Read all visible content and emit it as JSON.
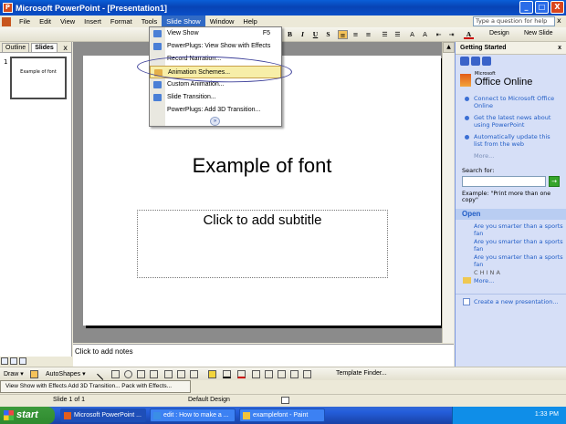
{
  "window": {
    "title": "Microsoft PowerPoint - [Presentation1]",
    "minimize_icon": "_",
    "maximize_icon": "□",
    "close_icon": "X"
  },
  "menubar": {
    "items": [
      "File",
      "Edit",
      "View",
      "Insert",
      "Format",
      "Tools",
      "Slide Show",
      "Window",
      "Help"
    ],
    "active": "Slide Show",
    "help_placeholder": "Type a question for help",
    "close_doc": "x"
  },
  "toolbar": {
    "bold": "B",
    "italic": "I",
    "underline": "U",
    "shadow": "S",
    "design": "Design",
    "new_slide": "New Slide",
    "font_color_label": "A"
  },
  "slides_panel": {
    "tab_outline": "Outline",
    "tab_slides": "Slides",
    "close": "x",
    "slide_number": "1",
    "thumb_text": "Example of font"
  },
  "slide": {
    "title": "Example of font",
    "subtitle_placeholder": "Click to add subtitle"
  },
  "notes": {
    "placeholder": "Click to add notes"
  },
  "dropdown": {
    "items": [
      {
        "label": "View Show",
        "shortcut": "F5"
      },
      {
        "label": "PowerPlugs: View Show with Effects",
        "shortcut": ""
      },
      {
        "label": "Record Narration...",
        "shortcut": ""
      },
      {
        "label": "Animation Schemes...",
        "shortcut": ""
      },
      {
        "label": "Custom Animation...",
        "shortcut": ""
      },
      {
        "label": "Slide Transition...",
        "shortcut": ""
      },
      {
        "label": "PowerPlugs: Add 3D Transition...",
        "shortcut": ""
      }
    ],
    "highlighted": "Animation Schemes...",
    "expand_icon": "»"
  },
  "taskpane": {
    "title": "Getting Started",
    "close": "x",
    "office_brand_small": "Microsoft",
    "office_brand": "Office Online",
    "links": [
      "Connect to Microsoft Office Online",
      "Get the latest news about using PowerPoint",
      "Automatically update this list from the web"
    ],
    "more": "More...",
    "search_label": "Search for:",
    "search_value": "",
    "search_go": "→",
    "example": "Example:  \"Print more than one copy\"",
    "open_title": "Open",
    "recent_files": [
      "Are you smarter than a sports fan",
      "Are you smarter than a sports fan",
      "Are you smarter than a sports fan",
      "C H I N A"
    ],
    "open_more": "More...",
    "create_new": "Create a new presentation..."
  },
  "drawbar": {
    "draw": "Draw ▾",
    "autoshapes": "AutoShapes ▾",
    "template_finder": "Template Finder..."
  },
  "effectsbar": {
    "text": "View Show with Effects  Add 3D Transition...  Pack with Effects..."
  },
  "statusbar": {
    "slide": "Slide 1 of 1",
    "design": "Default Design"
  },
  "taskbar": {
    "start": "start",
    "items": [
      "Microsoft PowerPoint ...",
      "edit : How to make a ...",
      "examplefont - Paint"
    ],
    "clock": "1:33 PM"
  }
}
